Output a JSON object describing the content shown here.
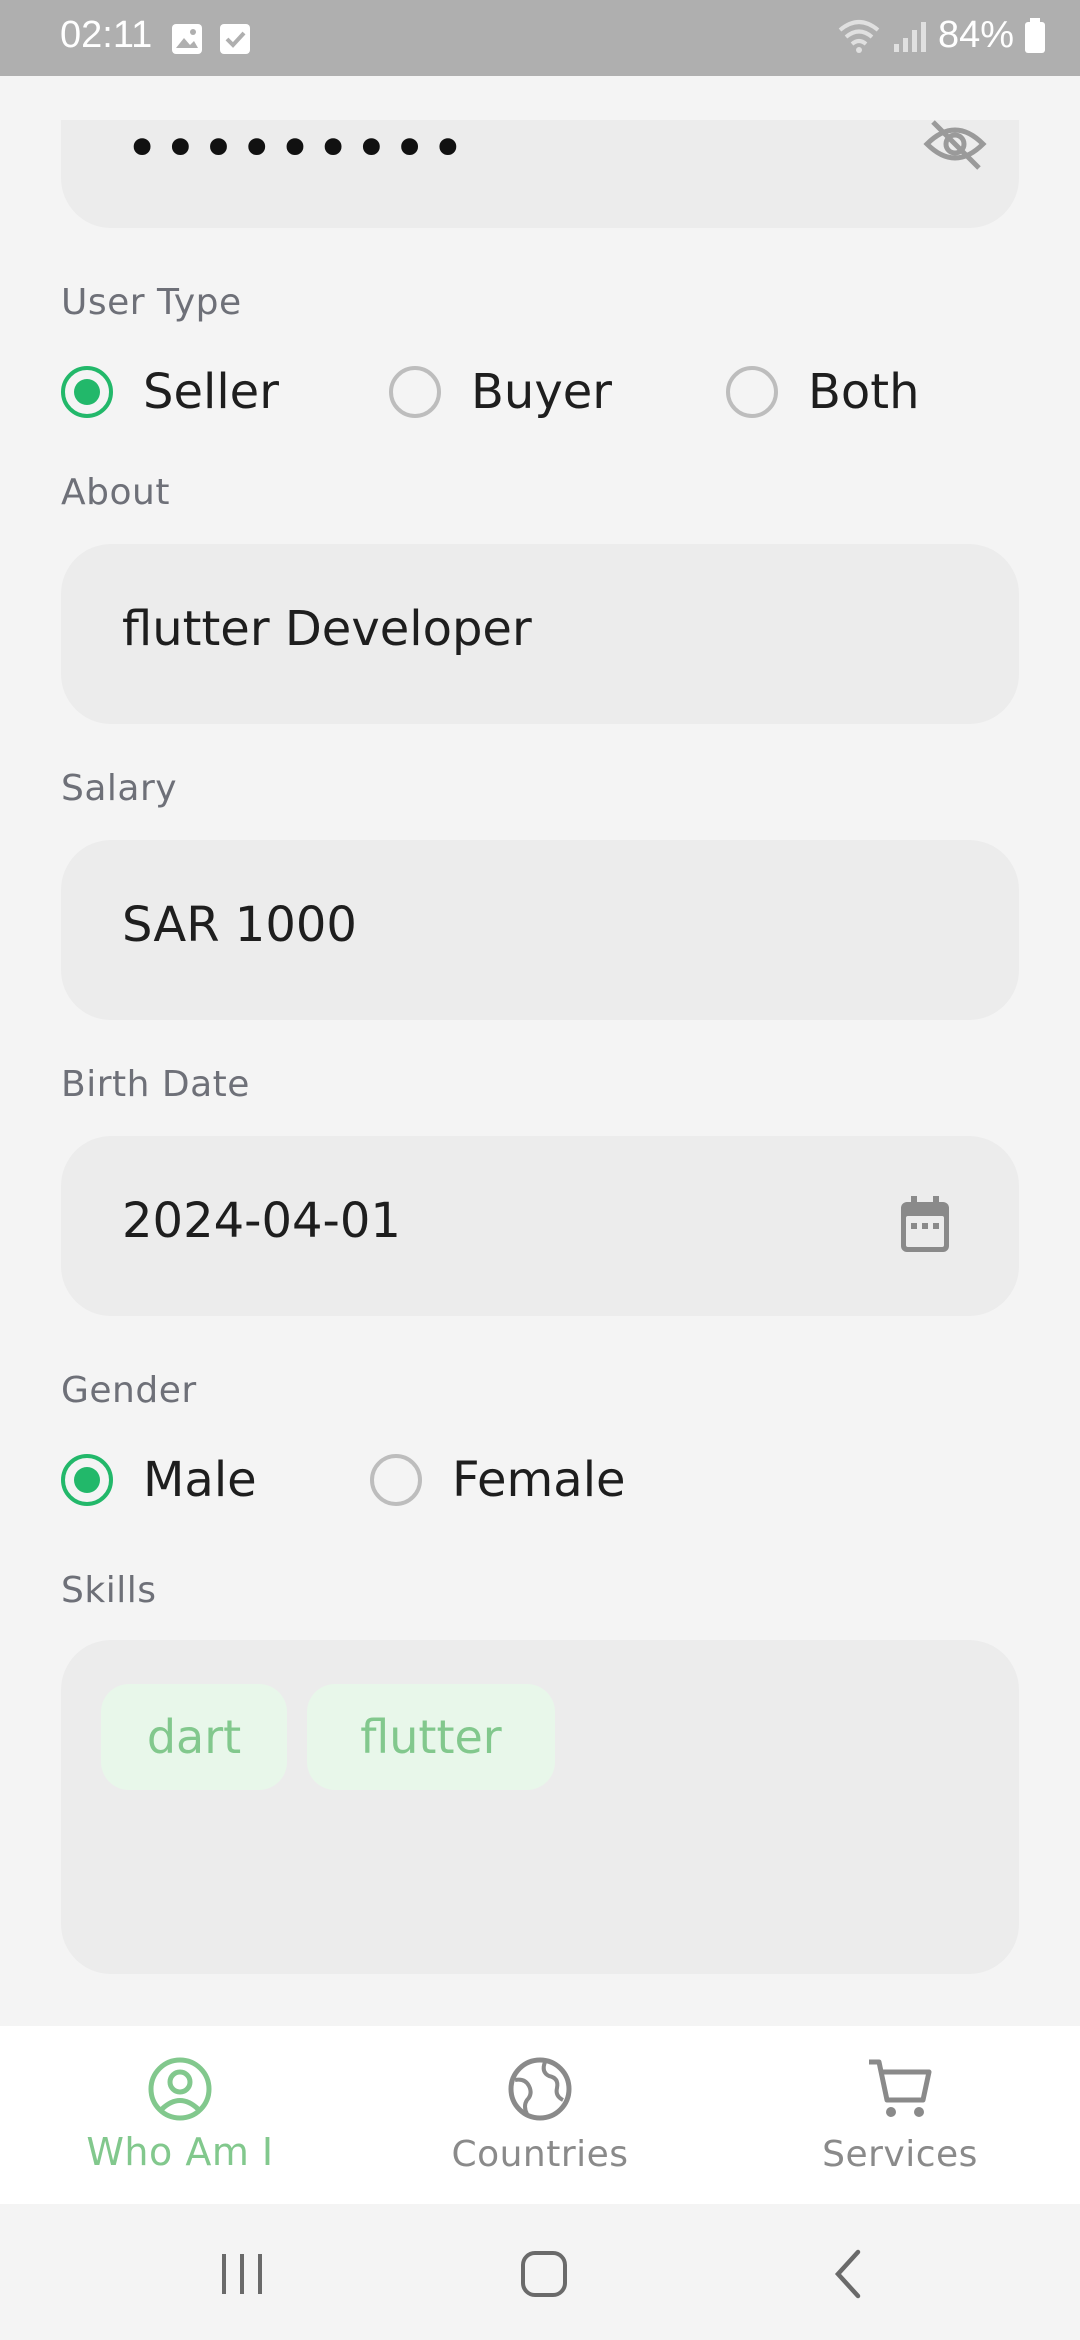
{
  "status_bar": {
    "time": "02:11",
    "battery": "84%"
  },
  "password": {
    "masked_value": "•••••••••"
  },
  "user_type": {
    "label": "User Type",
    "options": [
      "Seller",
      "Buyer",
      "Both"
    ],
    "selected": "Seller"
  },
  "about": {
    "label": "About",
    "value": "flutter Developer"
  },
  "salary": {
    "label": "Salary",
    "value": "SAR 1000"
  },
  "birth_date": {
    "label": "Birth Date",
    "value": "2024-04-01"
  },
  "gender": {
    "label": "Gender",
    "options": [
      "Male",
      "Female"
    ],
    "selected": "Male"
  },
  "skills": {
    "label": "Skills",
    "chips": [
      "dart",
      "flutter"
    ]
  },
  "bottom_nav": {
    "items": [
      {
        "label": "Who Am I",
        "icon": "user-circle-icon",
        "active": true
      },
      {
        "label": "Countries",
        "icon": "globe-icon",
        "active": false
      },
      {
        "label": "Services",
        "icon": "cart-icon",
        "active": false
      }
    ]
  },
  "colors": {
    "accent": "#22b86a",
    "nav_active": "#82c88d",
    "nav_inactive": "#8a8a8a",
    "chip_bg": "#e8f7ea",
    "chip_text": "#82c88d"
  }
}
